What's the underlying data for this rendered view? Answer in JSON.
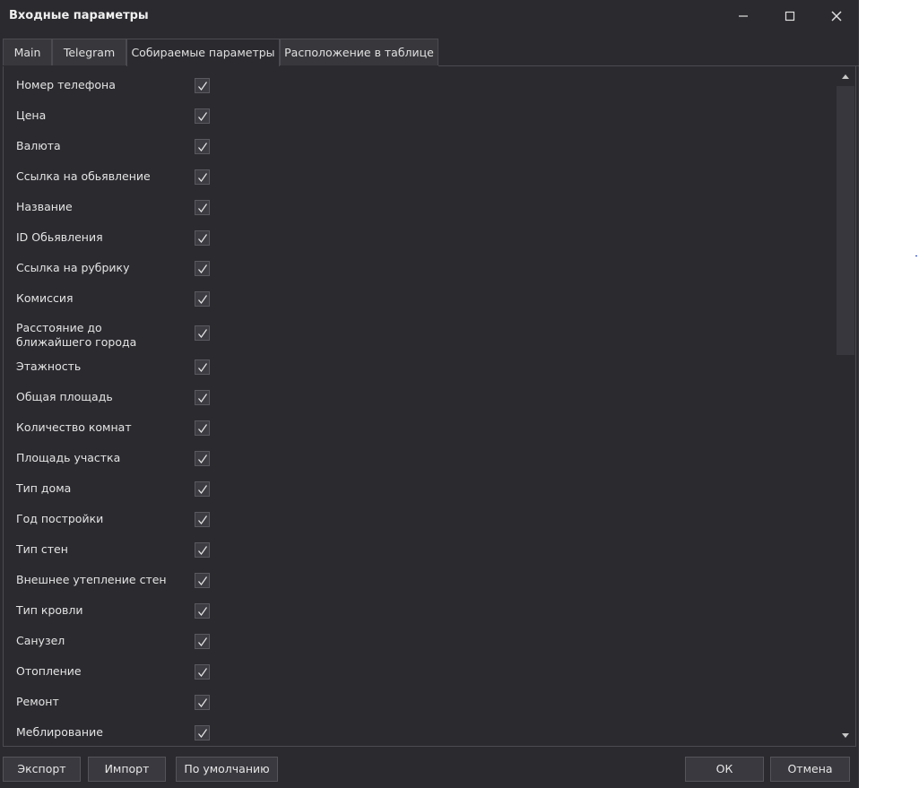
{
  "window": {
    "title": "Входные параметры"
  },
  "tabs": [
    {
      "label": "Main"
    },
    {
      "label": "Telegram"
    },
    {
      "label": "Собираемые параметры",
      "active": true
    },
    {
      "label": "Расположение в таблице"
    }
  ],
  "params": [
    {
      "label": "Номер телефона",
      "checked": true
    },
    {
      "label": "Цена",
      "checked": true
    },
    {
      "label": "Валюта",
      "checked": true
    },
    {
      "label": "Ссылка на обьявление",
      "checked": true
    },
    {
      "label": "Название",
      "checked": true
    },
    {
      "label": "ID Обьявления",
      "checked": true
    },
    {
      "label": "Ссылка на рубрику",
      "checked": true
    },
    {
      "label": "Комиссия",
      "checked": true
    },
    {
      "label": "Расстояние до ближайшего города",
      "checked": true
    },
    {
      "label": "Этажность",
      "checked": true
    },
    {
      "label": "Общая площадь",
      "checked": true
    },
    {
      "label": "Количество комнат",
      "checked": true
    },
    {
      "label": "Площадь участка",
      "checked": true
    },
    {
      "label": "Тип дома",
      "checked": true
    },
    {
      "label": "Год постройки",
      "checked": true
    },
    {
      "label": "Тип стен",
      "checked": true
    },
    {
      "label": "Внешнее утепление стен",
      "checked": true
    },
    {
      "label": "Тип кровли",
      "checked": true
    },
    {
      "label": "Санузел",
      "checked": true
    },
    {
      "label": "Отопление",
      "checked": true
    },
    {
      "label": "Ремонт",
      "checked": true
    },
    {
      "label": "Меблирование",
      "checked": true
    }
  ],
  "buttons": {
    "export": "Экспорт",
    "import": "Импорт",
    "defaults": "По умолчанию",
    "ok": "ОК",
    "cancel": "Отмена"
  },
  "colors": {
    "background": "#2b2a2f",
    "control": "#3a393f",
    "border": "#55545a",
    "text": "#e6e6e6"
  }
}
